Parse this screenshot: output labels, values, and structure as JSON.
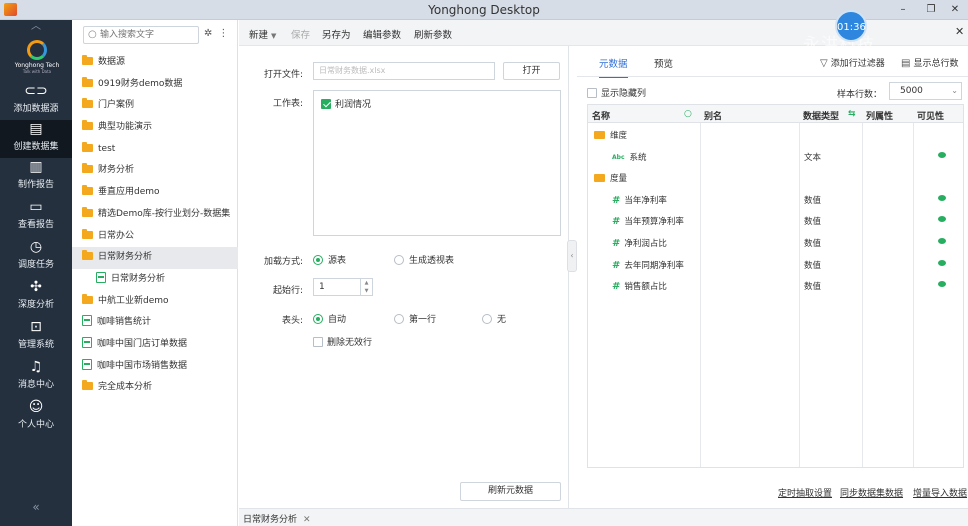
{
  "window": {
    "title": "Yonghong Desktop",
    "timer": "01:36",
    "watermark": "永洪科技"
  },
  "logo": {
    "name": "Yonghong Tech",
    "sub": "Talk with Data"
  },
  "nav": [
    {
      "label": "添加数据源",
      "icon": "link-icon"
    },
    {
      "label": "创建数据集",
      "icon": "dataset-icon"
    },
    {
      "label": "制作报告",
      "icon": "bar-chart-icon"
    },
    {
      "label": "查看报告",
      "icon": "monitor-chart-icon"
    },
    {
      "label": "调度任务",
      "icon": "clock-icon"
    },
    {
      "label": "深度分析",
      "icon": "network-icon"
    },
    {
      "label": "管理系统",
      "icon": "admin-icon"
    },
    {
      "label": "消息中心",
      "icon": "bell-icon"
    },
    {
      "label": "个人中心",
      "icon": "user-icon"
    }
  ],
  "tree": {
    "search_placeholder": "输入搜索文字",
    "items": [
      {
        "label": "数据源",
        "type": "folder"
      },
      {
        "label": "0919财务demo数据",
        "type": "folder"
      },
      {
        "label": "门户案例",
        "type": "folder"
      },
      {
        "label": "典型功能演示",
        "type": "folder"
      },
      {
        "label": "test",
        "type": "folder"
      },
      {
        "label": "财务分析",
        "type": "folder"
      },
      {
        "label": "垂直应用demo",
        "type": "folder"
      },
      {
        "label": "精选Demo库-按行业划分-数据集",
        "type": "folder"
      },
      {
        "label": "日常办公",
        "type": "folder"
      },
      {
        "label": "日常财务分析",
        "type": "folder"
      },
      {
        "label": "日常财务分析",
        "type": "dataset"
      },
      {
        "label": "中航工业新demo",
        "type": "folder"
      },
      {
        "label": "咖啡销售统计",
        "type": "dataset"
      },
      {
        "label": "咖啡中国门店订单数据",
        "type": "dataset"
      },
      {
        "label": "咖啡中国市场销售数据",
        "type": "dataset"
      },
      {
        "label": "完全成本分析",
        "type": "folder"
      }
    ]
  },
  "toolbar": {
    "new": "新建",
    "save": "保存",
    "save_as": "另存为",
    "edit_params": "编辑参数",
    "refresh_params": "刷新参数"
  },
  "form": {
    "open_file_label": "打开文件:",
    "open_file_value": "日常财务数据.xlsx",
    "open_button": "打开",
    "sheet_label": "工作表:",
    "sheet_item": "利润情况",
    "load_label": "加载方式:",
    "load_opt1": "源表",
    "load_opt2": "生成透视表",
    "start_label": "起始行:",
    "start_value": "1",
    "header_label": "表头:",
    "header_opt1": "自动",
    "header_opt2": "第一行",
    "header_opt3": "无",
    "delete_invalid": "删除无效行",
    "refresh_meta": "刷新元数据"
  },
  "right": {
    "tab_meta": "元数据",
    "tab_preview": "预览",
    "add_filter": "添加行过滤器",
    "show_total": "显示总行数",
    "show_hidden": "显示隐藏列",
    "sample_label": "样本行数：",
    "sample_value": "5000",
    "columns": {
      "name": "名称",
      "alias": "别名",
      "dtype": "数据类型",
      "attr": "列属性",
      "visible": "可见性"
    },
    "rows": [
      {
        "kind": "dir",
        "name": "维度",
        "dtype": ""
      },
      {
        "kind": "text",
        "name": "系统",
        "dtype": "文本"
      },
      {
        "kind": "dir",
        "name": "度量",
        "dtype": ""
      },
      {
        "kind": "num",
        "name": "当年净利率",
        "dtype": "数值"
      },
      {
        "kind": "num",
        "name": "当年预算净利率",
        "dtype": "数值"
      },
      {
        "kind": "num",
        "name": "净利润占比",
        "dtype": "数值"
      },
      {
        "kind": "num",
        "name": "去年同期净利率",
        "dtype": "数值"
      },
      {
        "kind": "num",
        "name": "销售额占比",
        "dtype": "数值"
      }
    ],
    "foot_schedule": "定时抽取设置",
    "foot_sync": "同步数据集数据",
    "foot_increment": "增量导入数据"
  },
  "bottom_tab": "日常财务分析"
}
